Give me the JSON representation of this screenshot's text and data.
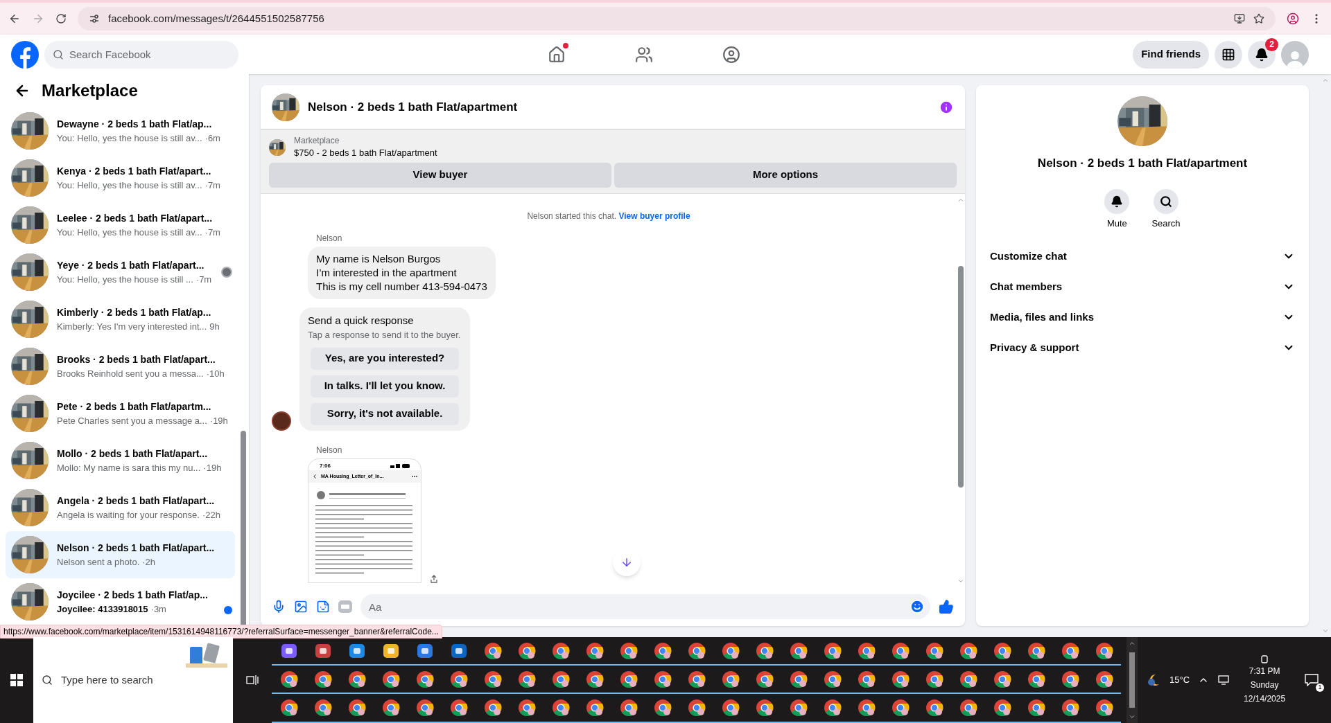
{
  "browser": {
    "url": "facebook.com/messages/t/2644551502587756",
    "status_url": "https://www.facebook.com/marketplace/item/1531614948116773/?referralSurface=messenger_banner&referralCode..."
  },
  "header": {
    "search_placeholder": "Search Facebook",
    "find_friends": "Find friends",
    "notification_count": "2",
    "home_has_dot": true
  },
  "sidebar": {
    "title": "Marketplace",
    "conversations": [
      {
        "name": "Dewayne · 2 beds 1 bath Flat/ap...",
        "preview": "You: Hello, yes the house is still av...",
        "time": "·6m",
        "selected": false,
        "unread": false,
        "seen": false
      },
      {
        "name": "Kenya · 2 beds 1 bath Flat/apart...",
        "preview": "You: Hello, yes the house is still av...",
        "time": "·7m",
        "selected": false,
        "unread": false,
        "seen": false
      },
      {
        "name": "Leelee · 2 beds 1 bath Flat/apart...",
        "preview": "You: Hello, yes the house is still av...",
        "time": "·7m",
        "selected": false,
        "unread": false,
        "seen": false
      },
      {
        "name": "Yeye · 2 beds 1 bath Flat/apart...",
        "preview": "You: Hello, yes the house is still ...",
        "time": "·7m",
        "selected": false,
        "unread": false,
        "seen": true
      },
      {
        "name": "Kimberly · 2 beds 1 bath Flat/ap...",
        "preview": "Kimberly: Yes I'm very interested int...",
        "time": "9h",
        "selected": false,
        "unread": false,
        "seen": false
      },
      {
        "name": "Brooks · 2 beds 1 bath Flat/apart...",
        "preview": "Brooks Reinhold sent you a messa...",
        "time": "·10h",
        "selected": false,
        "unread": false,
        "seen": false
      },
      {
        "name": "Pete · 2 beds 1 bath Flat/apartm...",
        "preview": "Pete Charles sent you a message a...",
        "time": "·19h",
        "selected": false,
        "unread": false,
        "seen": false
      },
      {
        "name": "Mollo · 2 beds 1 bath Flat/apart...",
        "preview": "Mollo: My name is sara this my nu...",
        "time": "·19h",
        "selected": false,
        "unread": false,
        "seen": false
      },
      {
        "name": "Angela · 2 beds 1 bath Flat/apart...",
        "preview": "Angela is waiting for your response.",
        "time": "·22h",
        "selected": false,
        "unread": false,
        "seen": false
      },
      {
        "name": "Nelson · 2 beds 1 bath Flat/apart...",
        "preview": "Nelson sent a photo.",
        "time": "·2h",
        "selected": true,
        "unread": false,
        "seen": false
      },
      {
        "name": "Joycilee · 2 beds 1 bath Flat/ap...",
        "preview": "Joycilee: 4133918015",
        "time": "·3m",
        "selected": false,
        "unread": true,
        "seen": false
      }
    ]
  },
  "chat": {
    "title": "Nelson · 2 beds 1 bath Flat/apartment",
    "listing": {
      "label": "Marketplace",
      "text": "$750 - 2 beds 1 bath Flat/apartment"
    },
    "buttons": [
      "View buyer",
      "More options"
    ],
    "system": {
      "text": "Nelson started this chat.",
      "link": "View buyer profile"
    },
    "messages": [
      {
        "kind": "text",
        "sender": "Nelson",
        "lines": [
          "My name is Nelson Burgos",
          "I’m interested in the apartment",
          "This is my cell number 413-594-0473"
        ]
      },
      {
        "kind": "quick_responses",
        "title": "Send a quick response",
        "hint": "Tap a response to send it to the buyer.",
        "options": [
          "Yes, are you interested?",
          "In talks. I'll let you know.",
          "Sorry, it's not available."
        ]
      },
      {
        "sender": "Nelson",
        "time": "7:06",
        "file": "MA Housing_Letter_of_In..."
      }
    ],
    "composer_placeholder": "Aa"
  },
  "details": {
    "title": "Nelson · 2 beds 1 bath Flat/apartment",
    "actions": [
      {
        "kind": "mute",
        "label": "Mute"
      },
      {
        "kind": "search",
        "label": "Search"
      }
    ],
    "sections": [
      {
        "label": "Customize chat",
        "expanded": false
      },
      {
        "label": "Chat members",
        "expanded": false
      },
      {
        "label": "Media, files and links",
        "expanded": false
      },
      {
        "label": "Privacy & support",
        "expanded": false
      }
    ]
  },
  "taskbar": {
    "search_placeholder": "Type here to search",
    "temperature": "15°C",
    "time": "7:31 PM",
    "day": "Sunday",
    "date": "12/14/2025",
    "notification_count": "1"
  }
}
